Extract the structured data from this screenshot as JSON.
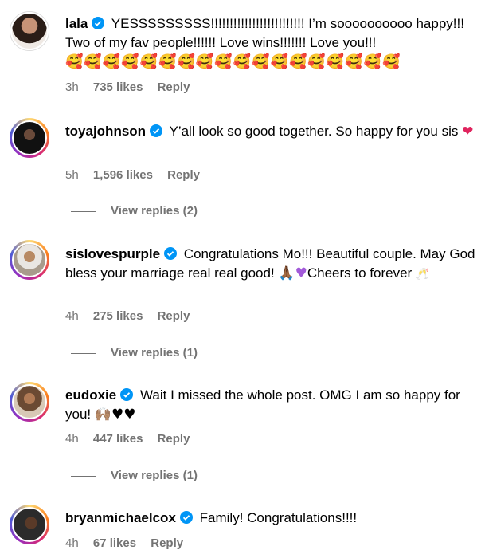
{
  "comments": [
    {
      "username": "lala",
      "text": "YESSSSSSSSS!!!!!!!!!!!!!!!!!!!!!!!!! I’m soooooooooo happy!!! Two of my fav people!!!!!! Love wins!!!!!!! Love you!!!",
      "emoji": "🥰🥰🥰🥰🥰🥰🥰🥰🥰🥰🥰🥰🥰🥰🥰🥰🥰🥰",
      "time": "3h",
      "likes": "735 likes",
      "reply": "Reply"
    },
    {
      "username": "toyajohnson",
      "text": "Y’all look so good together. So happy for you sis",
      "emoji": "❤",
      "time": "5h",
      "likes": "1,596 likes",
      "reply": "Reply",
      "view_replies": "View replies (2)"
    },
    {
      "username": "sislovespurple",
      "text_a": "Congratulations Mo!!! Beautiful couple. May God bless your marriage real real good!",
      "emoji_a": "🙏🏾",
      "emoji_b": "♥",
      "text_b": "Cheers to forever",
      "emoji_c": "🥂",
      "time": "4h",
      "likes": "275 likes",
      "reply": "Reply",
      "view_replies": "View replies (1)"
    },
    {
      "username": "eudoxie",
      "text": "Wait I missed the whole post. OMG I am so happy for you!",
      "emoji_a": "🙌🏽",
      "emoji_b": "♥♥",
      "time": "4h",
      "likes": "447 likes",
      "reply": "Reply",
      "view_replies": "View replies (1)"
    },
    {
      "username": "bryanmichaelcox",
      "text": "Family! Congratulations!!!!",
      "time": "4h",
      "likes": "67 likes",
      "reply": "Reply"
    }
  ],
  "colors": {
    "verified": "#0095f6",
    "muted": "#737373"
  },
  "icons": {
    "verified": "verified-badge-icon"
  }
}
